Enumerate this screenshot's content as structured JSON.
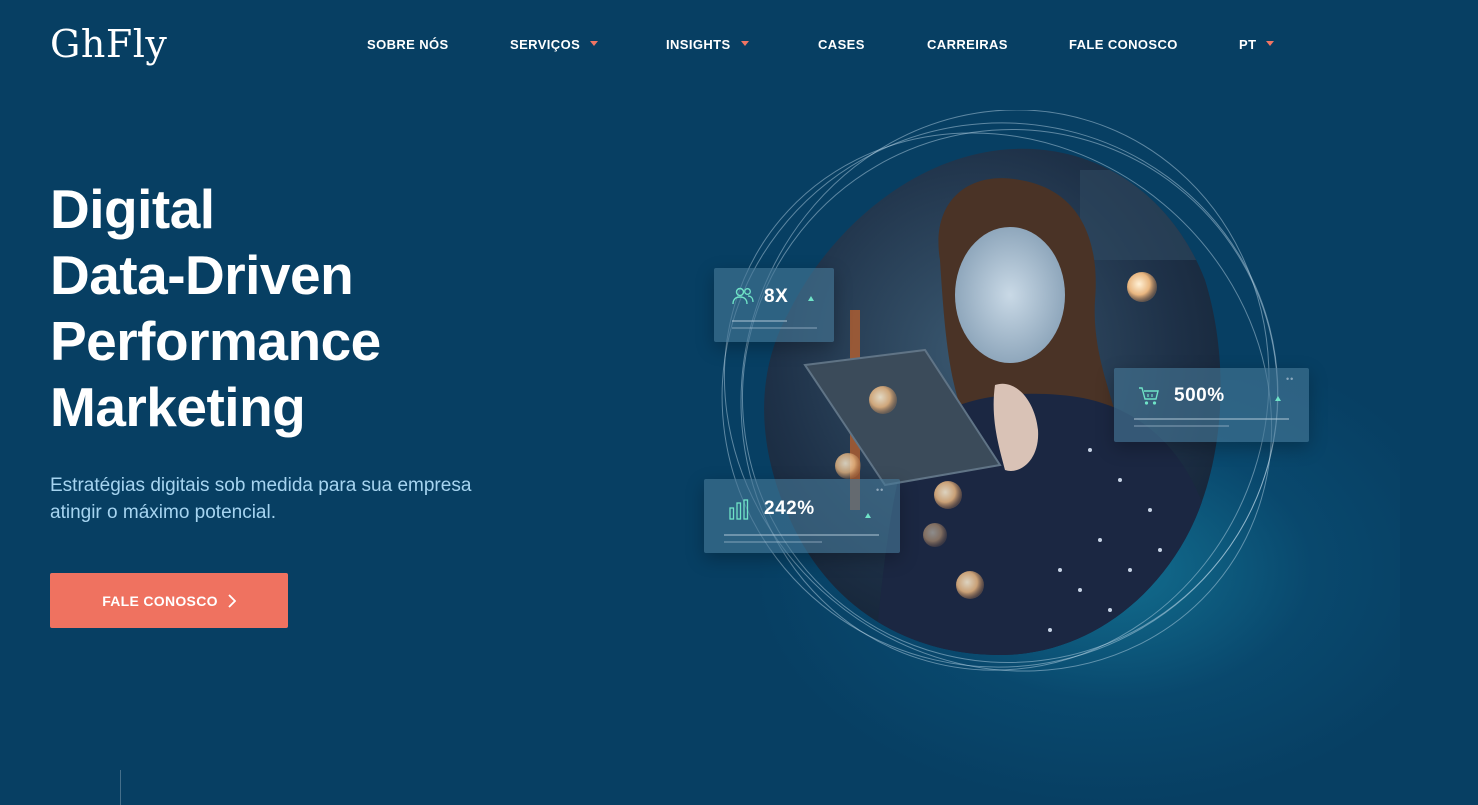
{
  "brand": {
    "logo_text": "GhFly"
  },
  "nav": {
    "items": [
      {
        "label": "SOBRE NÓS",
        "has_dropdown": false
      },
      {
        "label": "SERVIÇOS",
        "has_dropdown": true
      },
      {
        "label": "INSIGHTS",
        "has_dropdown": true
      },
      {
        "label": "CASES",
        "has_dropdown": false
      },
      {
        "label": "CARREIRAS",
        "has_dropdown": false
      },
      {
        "label": "FALE CONOSCO",
        "has_dropdown": false
      },
      {
        "label": "PT",
        "has_dropdown": true
      }
    ]
  },
  "hero": {
    "title_lines": [
      "Digital",
      "Data-Driven",
      "Performance",
      "Marketing"
    ],
    "subtitle": "Estratégias digitais sob medida para sua empresa atingir o máximo potencial.",
    "cta_label": "FALE CONOSCO",
    "cta_icon": "chevron-right-icon"
  },
  "stats": [
    {
      "value": "8X",
      "icon": "users-icon",
      "trend": "up"
    },
    {
      "value": "500%",
      "icon": "cart-icon",
      "trend": "up"
    },
    {
      "value": "242%",
      "icon": "bar-chart-icon",
      "trend": "up"
    }
  ],
  "colors": {
    "background": "#073f63",
    "accent": "#ef7260",
    "subtitle": "#a6d4f0",
    "trend_up": "#6fe3c7"
  }
}
